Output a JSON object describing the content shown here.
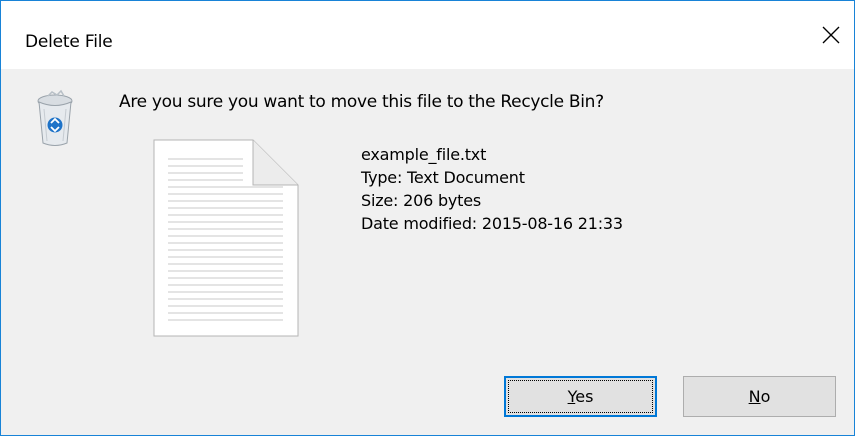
{
  "window": {
    "title": "Delete File",
    "close_glyph": "✕"
  },
  "message": {
    "question": "Are you sure you want to move this file to the Recycle Bin?"
  },
  "file": {
    "name": "example_file.txt",
    "type": "Type: Text Document",
    "size": "Size: 206 bytes",
    "date_modified": "Date modified: 2015-08-16 21:33"
  },
  "buttons": {
    "yes_key": "Y",
    "yes_rest": "es",
    "no_key": "N",
    "no_rest": "o"
  },
  "icons": {
    "header": "recycle-bin-icon",
    "file": "text-document-icon",
    "close": "close-icon"
  },
  "colors": {
    "window_border": "#1883d7",
    "dialog_bg": "#f0f0f0",
    "button_bg": "#e1e1e1",
    "default_button_border": "#0078d7"
  }
}
